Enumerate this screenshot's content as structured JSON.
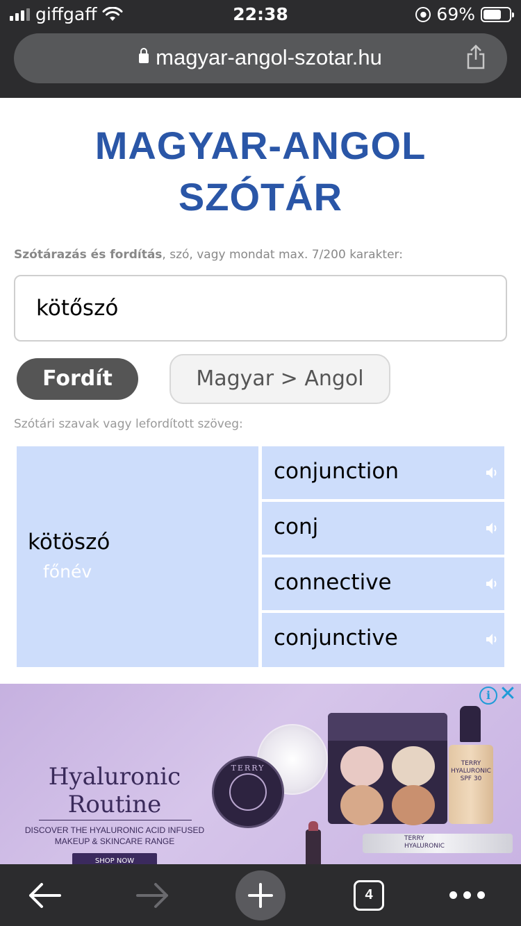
{
  "status_bar": {
    "carrier": "giffgaff",
    "time": "22:38",
    "battery_percent": "69%",
    "battery_level": 0.69
  },
  "browser": {
    "url": "magyar-angol-szotar.hu",
    "open_tabs": "4"
  },
  "page": {
    "title_line1": "MAGYAR-ANGOL",
    "title_line2": "SZÓTÁR",
    "hint_bold": "Szótárazás és fordítás",
    "hint_rest": ", szó, vagy mondat max. 7/200 karakter:",
    "search_value": "kötőszó",
    "translate_button": "Fordít",
    "language_selector": "Magyar > Angol",
    "result_hint": "Szótári szavak vagy lefordított szöveg:",
    "colors": {
      "title": "#2a56a7",
      "cell_bg": "#cdddfb",
      "button_bg": "#555555"
    }
  },
  "results": {
    "source_word": "kötöszó",
    "part_of_speech": "főnév",
    "translations": [
      {
        "word": "conjunction"
      },
      {
        "word": "conj"
      },
      {
        "word": "connective"
      },
      {
        "word": "conjunctive"
      }
    ]
  },
  "ad": {
    "headline_line1": "Hyaluronic",
    "headline_line2": "Routine",
    "description": "DISCOVER THE HYALURONIC ACID INFUSED MAKEUP & SKINCARE RANGE",
    "cta": "SHOP NOW",
    "brand": "TERRY",
    "bottle_label_1": "TERRY",
    "bottle_label_2": "HYALURONIC",
    "bottle_label_3": "SPF 30",
    "pen_label_1": "TERRY",
    "pen_label_2": "HYALURONIC"
  }
}
